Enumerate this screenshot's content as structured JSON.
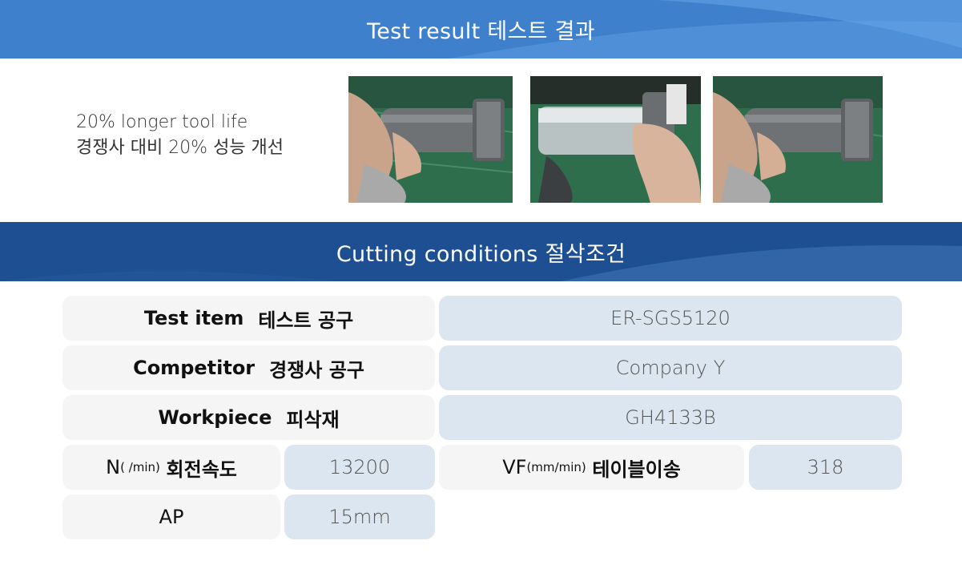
{
  "header": {
    "title": "Test result  테스트 결과"
  },
  "result": {
    "line1": "20% longer tool life",
    "line2": "경쟁사 대비 20% 성능 개선"
  },
  "photos": [
    {
      "name": "test-photo-1"
    },
    {
      "name": "test-photo-2"
    },
    {
      "name": "test-photo-3"
    }
  ],
  "conditions": {
    "title": "Cutting conditions  절삭조건",
    "test_item": {
      "en": "Test item",
      "ko": "테스트 공구",
      "value": "ER-SGS5120"
    },
    "competitor": {
      "en": "Competitor",
      "ko": "경쟁사 공구",
      "value": "Company Y"
    },
    "workpiece": {
      "en": "Workpiece",
      "ko": "피삭재",
      "value": "GH4133B"
    },
    "n": {
      "en_big": "N",
      "en_small": "( /min)",
      "ko": "회전속도",
      "value": "13200"
    },
    "vf": {
      "en_big": "VF",
      "en_small": "(mm/min)",
      "ko": "테이블이송",
      "value": "318"
    },
    "ap": {
      "label": "AP",
      "value": "15mm"
    }
  },
  "colors": {
    "banner_top": "#3f80cc",
    "banner_bottom": "#1d4f92",
    "label_bg": "#f5f5f5",
    "value_bg": "#dce6f0"
  }
}
